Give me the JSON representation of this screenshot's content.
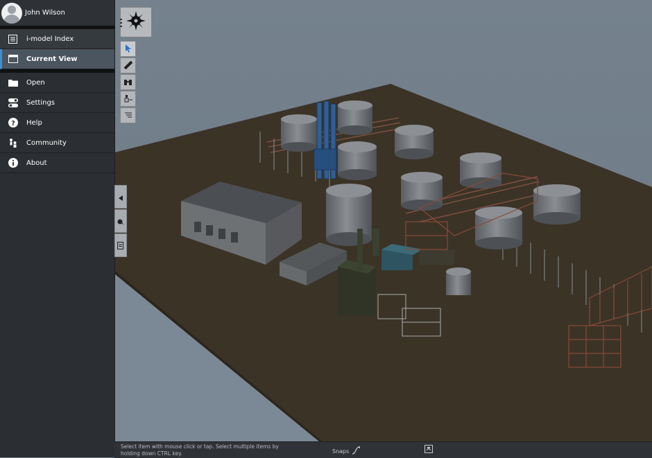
{
  "user": {
    "name": "John Wilson",
    "avatar_icon": "user-avatar-icon"
  },
  "menu": {
    "top_items": [
      {
        "label": "i-model Index",
        "icon": "index-icon"
      },
      {
        "label": "Current View",
        "icon": "window-icon"
      }
    ],
    "items": [
      {
        "label": "Open",
        "icon": "folder-icon"
      },
      {
        "label": "Settings",
        "icon": "toggle-icon"
      },
      {
        "label": "Help",
        "icon": "question-icon"
      },
      {
        "label": "Community",
        "icon": "community-icon"
      },
      {
        "label": "About",
        "icon": "info-icon"
      }
    ]
  },
  "toolbar": {
    "main_tool_icon": "compass-gear-icon",
    "tools": [
      "select-arrow-icon",
      "measure-ruler-icon",
      "binoculars-icon",
      "properties-icon",
      "layers-icon"
    ]
  },
  "side_panel": {
    "buttons": [
      "panel-toggle-icon",
      "markup-icon",
      "report-icon"
    ]
  },
  "status": {
    "hint": "Select item with mouse click or tap. Select multiple items by holding down CTRL key.",
    "snaps_label": "Snaps"
  },
  "colors": {
    "sidebar_bg": "#2b2f33",
    "active_item": "#4b5560",
    "accent": "#3d8fd6",
    "ground": "#3b3326",
    "sky": "#6d7a86"
  }
}
